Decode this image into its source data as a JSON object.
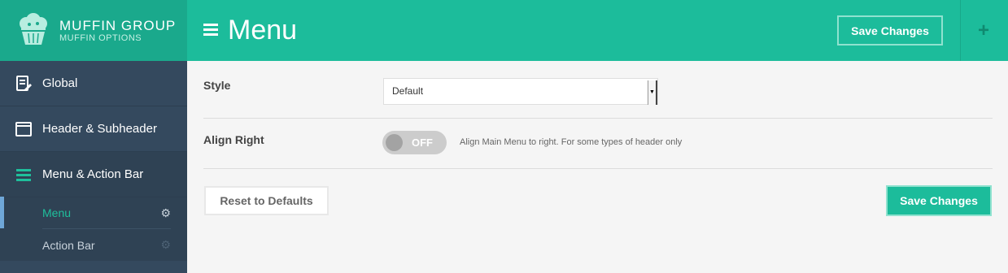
{
  "brand": {
    "title": "MUFFIN GROUP",
    "subtitle": "MUFFIN OPTIONS",
    "icon": "muffin-icon"
  },
  "sidebar": {
    "items": [
      {
        "label": "Global",
        "icon": "document-edit-icon"
      },
      {
        "label": "Header & Subheader",
        "icon": "window-icon"
      },
      {
        "label": "Menu & Action Bar",
        "icon": "hamburger-icon",
        "active": true
      }
    ],
    "subitems": [
      {
        "label": "Menu",
        "icon": "gear-icon",
        "active": true
      },
      {
        "label": "Action Bar",
        "icon": "gear-icon",
        "active": false
      }
    ]
  },
  "header": {
    "title": "Menu",
    "save_label": "Save Changes",
    "plus_label": "+"
  },
  "settings": {
    "style": {
      "label": "Style",
      "value": "Default"
    },
    "align_right": {
      "label": "Align Right",
      "toggle_text": "OFF",
      "hint": "Align Main Menu to right. For some types of header only"
    }
  },
  "footer": {
    "reset_label": "Reset to Defaults",
    "save_label": "Save Changes"
  },
  "colors": {
    "accent": "#1cbc9b",
    "sidebar": "#34495e",
    "active_text": "#1fbf9c"
  }
}
